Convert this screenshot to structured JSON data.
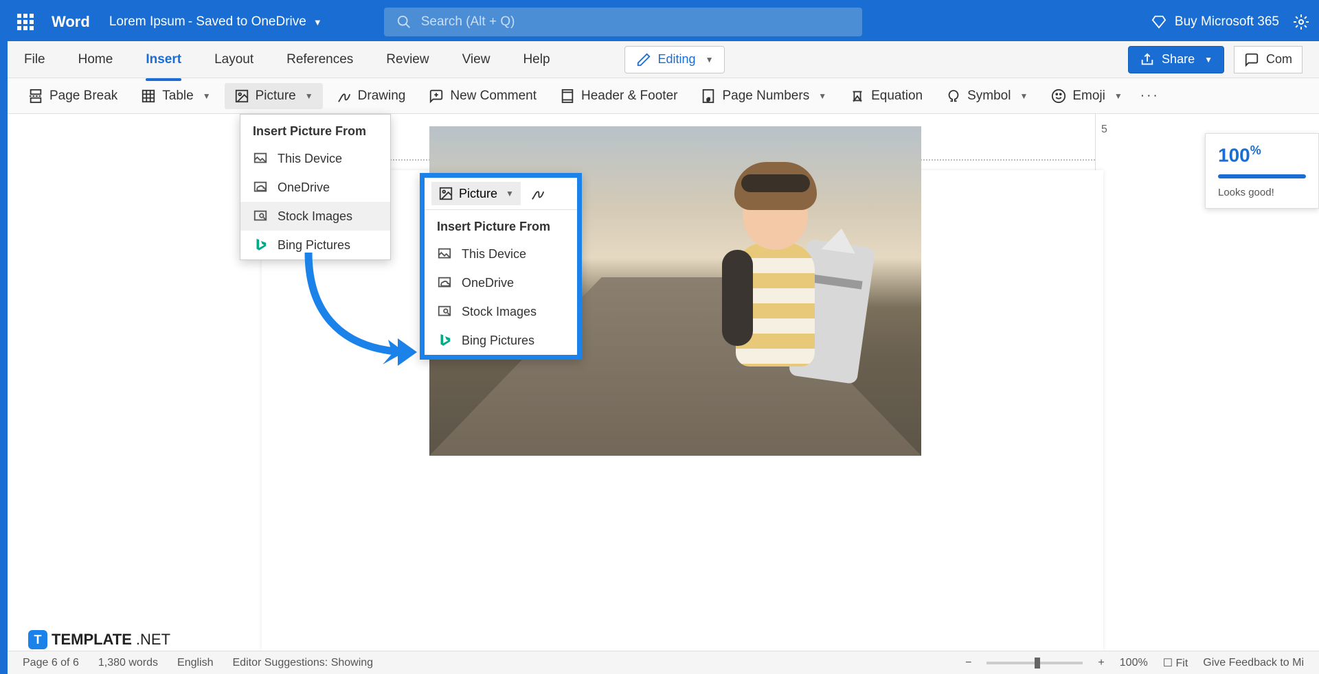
{
  "titlebar": {
    "app_name": "Word",
    "doc_name": "Lorem Ipsum",
    "save_status": "- Saved to OneDrive",
    "search_placeholder": "Search (Alt + Q)",
    "buy_label": "Buy Microsoft 365"
  },
  "tabs": {
    "file": "File",
    "home": "Home",
    "insert": "Insert",
    "layout": "Layout",
    "references": "References",
    "review": "Review",
    "view": "View",
    "help": "Help",
    "editing": "Editing",
    "share": "Share",
    "comment": "Com"
  },
  "ribbon": {
    "page_break": "Page Break",
    "table": "Table",
    "picture": "Picture",
    "drawing": "Drawing",
    "new_comment": "New Comment",
    "header_footer": "Header & Footer",
    "page_numbers": "Page Numbers",
    "equation": "Equation",
    "symbol": "Symbol",
    "emoji": "Emoji"
  },
  "dropdown": {
    "header": "Insert Picture From",
    "this_device": "This Device",
    "onedrive": "OneDrive",
    "stock_images": "Stock Images",
    "bing_pictures": "Bing Pictures"
  },
  "dd2": {
    "picture": "Picture",
    "header": "Insert Picture From"
  },
  "ruler": {
    "mark5": "5"
  },
  "editor_panel": {
    "score": "100",
    "pct": "%",
    "status": "Looks good!"
  },
  "status": {
    "page": "Page 6 of 6",
    "words": "1,380 words",
    "lang": "English",
    "suggest": "Editor Suggestions: Showing",
    "zoom": "100%",
    "fit": "Fit",
    "feedback": "Give Feedback to Mi"
  },
  "watermark": {
    "text": "TEMPLATE",
    "suffix": ".NET"
  }
}
